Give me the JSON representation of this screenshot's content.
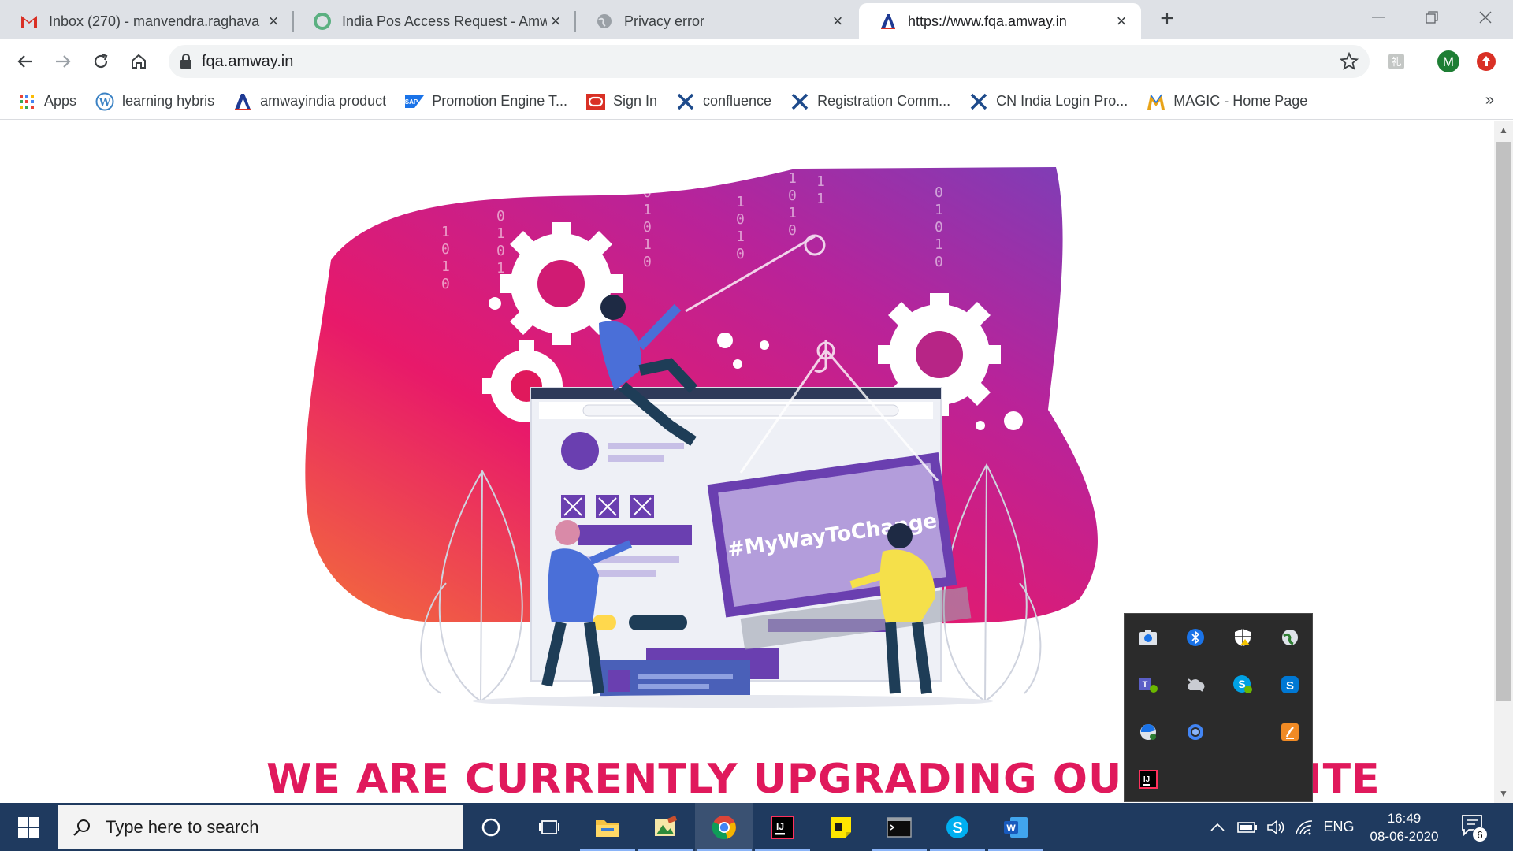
{
  "browser": {
    "tabs": [
      {
        "title": "Inbox (270) - manvendra.raghava",
        "favicon": "gmail-icon",
        "active": false
      },
      {
        "title": "India Pos Access Request - Amwa",
        "favicon": "green-circle-icon",
        "active": false
      },
      {
        "title": "Privacy error",
        "favicon": "globe-icon",
        "active": false
      },
      {
        "title": "https://www.fqa.amway.in",
        "favicon": "amway-a-icon",
        "active": true
      }
    ],
    "new_tab_label": "+",
    "url": "fqa.amway.in",
    "profile_initial": "M",
    "bookmarks": [
      {
        "label": "Apps",
        "icon": "apps-grid-icon"
      },
      {
        "label": "learning hybris",
        "icon": "wordpress-icon"
      },
      {
        "label": "amwayindia product",
        "icon": "amway-a-icon"
      },
      {
        "label": "Promotion Engine T...",
        "icon": "sap-icon"
      },
      {
        "label": "Sign In",
        "icon": "oracle-icon"
      },
      {
        "label": "confluence",
        "icon": "confluence-x-icon"
      },
      {
        "label": "Registration Comm...",
        "icon": "confluence-x-icon"
      },
      {
        "label": "CN India Login Pro...",
        "icon": "confluence-x-icon"
      },
      {
        "label": "MAGIC - Home Page",
        "icon": "magic-m-icon"
      }
    ],
    "bookmarks_overflow": "»"
  },
  "page": {
    "hashtag": "#MyWayToChange",
    "headline": "WE ARE CURRENTLY UPGRADING OUR WEBSITE",
    "colors": {
      "pink": "#e0195c",
      "purple": "#7b3fb8",
      "orange": "#f36f3a"
    }
  },
  "tray_popup": {
    "icons": [
      "camera-app-icon",
      "bluetooth-icon",
      "security-shield-icon",
      "globe-sync-icon",
      "teams-icon",
      "onedrive-icon",
      "skype-business-icon",
      "skype-icon",
      "edge-sync-icon",
      "chrome-remote-icon",
      "java-update-icon",
      "intellij-icon"
    ]
  },
  "taskbar": {
    "search_placeholder": "Type here to search",
    "apps": [
      "cortana-icon",
      "task-view-icon",
      "file-explorer-icon",
      "image-editor-icon",
      "chrome-icon",
      "intellij-icon",
      "sticky-notes-icon",
      "terminal-icon",
      "skype-icon",
      "word-icon"
    ],
    "language": "ENG",
    "time": "16:49",
    "date": "08-06-2020",
    "notification_count": "6"
  }
}
